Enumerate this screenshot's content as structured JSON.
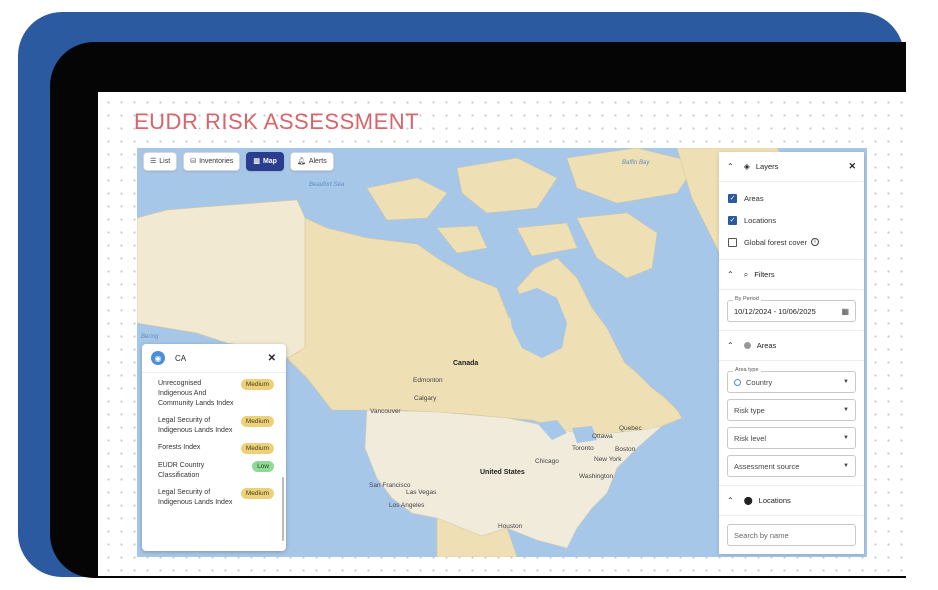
{
  "page_title": "EUDR RISK ASSESSMENT",
  "toolbar": [
    {
      "label": "List",
      "icon": "list-icon",
      "active": false
    },
    {
      "label": "Inventories",
      "icon": "inventory-icon",
      "active": false
    },
    {
      "label": "Map",
      "icon": "map-icon",
      "active": true
    },
    {
      "label": "Alerts",
      "icon": "bell-icon",
      "active": false
    }
  ],
  "map_labels": {
    "canada": "Canada",
    "edmonton": "Edmonton",
    "calgary": "Calgary",
    "vancouver": "Vancouver",
    "ottawa": "Ottawa",
    "quebec": "Quebec",
    "toronto": "Toronto",
    "new_york": "New York",
    "boston": "Boston",
    "washington": "Washington",
    "chicago": "Chicago",
    "united_states": "United States",
    "san_francisco": "San Francisco",
    "las_vegas": "Las Vegas",
    "los_angeles": "Los Angeles",
    "houston": "Houston",
    "beaufort_sea": "Beaufort Sea",
    "baffin_bay": "Baffin Bay",
    "bering": "Bering"
  },
  "popup": {
    "country_code": "CA",
    "close_label": "✕",
    "indices": [
      {
        "name": "Unrecognised Indigenous And Community Lands Index",
        "level": "Medium"
      },
      {
        "name": "Legal Security of Indigenous Lands Index",
        "level": "Medium"
      },
      {
        "name": "Forests Index",
        "level": "Medium"
      },
      {
        "name": "EUDR Country Classification",
        "level": "Low"
      },
      {
        "name": "Legal Security of Indigenous Lands Index",
        "level": "Medium"
      }
    ]
  },
  "panel": {
    "layers_title": "Layers",
    "close_label": "✕",
    "layers": [
      {
        "label": "Areas",
        "checked": true
      },
      {
        "label": "Locations",
        "checked": true
      },
      {
        "label": "Global forest cover",
        "checked": false
      }
    ],
    "filters_title": "Filters",
    "period_label": "By Period",
    "period_value": "10/12/2024  - 10/06/2025",
    "areas_title": "Areas",
    "area_type_label": "Area type",
    "area_type_value": "Country",
    "risk_type": "Risk type",
    "risk_level": "Risk level",
    "assessment_source": "Assessment source",
    "locations_title": "Locations",
    "search_placeholder": "Search by name"
  },
  "colors": {
    "brand_blue": "#2c5aa0",
    "title": "#d9646c",
    "map_active": "#2a3d8f",
    "badge_medium": "#ecd07a",
    "badge_low": "#8fd896"
  }
}
